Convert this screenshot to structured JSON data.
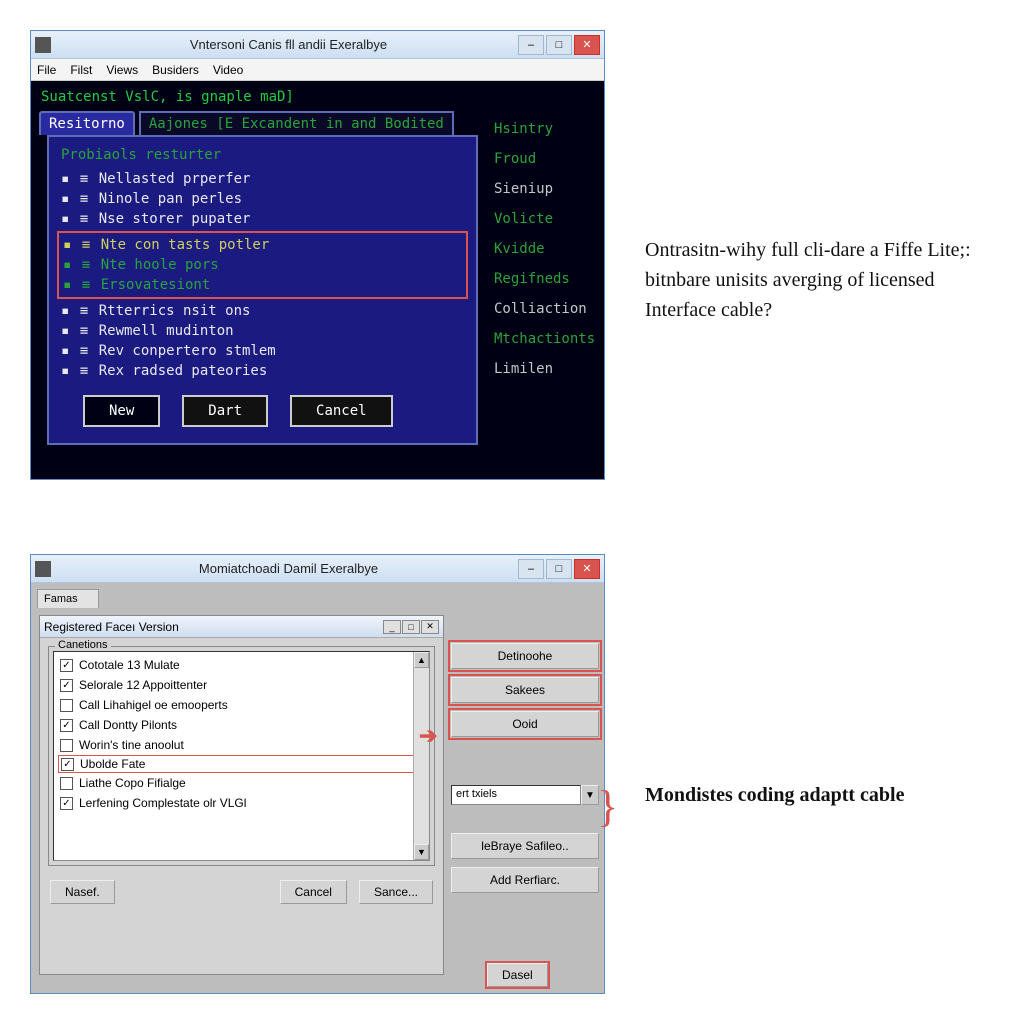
{
  "win1": {
    "title": "Vntersoni Canis fll andii Exeralbye",
    "menu": [
      "File",
      "Filst",
      "Views",
      "Busiders",
      "Video"
    ],
    "status": "Suatcenst VslC, is gnaple maD]",
    "tabs": [
      "Resitorno",
      "Aajones [E Excandent in and Bodited"
    ],
    "panel_heading": "Probiaols resturter",
    "list_pre": [
      "Nellasted prperfer",
      "Ninole pan perles",
      "Nse storer pupater"
    ],
    "list_hl": [
      "Nte con tasts potler",
      "Nte hoole pors",
      "Ersovatesiont"
    ],
    "list_post": [
      "Rtterrics nsit ons",
      "Rewmell mudinton",
      "Rev conpertero stmlem",
      "Rex radsed pateories"
    ],
    "buttons": [
      "New",
      "Dart",
      "Cancel"
    ],
    "sidebar": [
      "Hsintry",
      "Froud",
      "Sieniup",
      "Volicte",
      "Kvidde",
      "Regifneds",
      "Colliaction",
      "Mtchactionts",
      "Limilen"
    ]
  },
  "caption1": "Ontrasitn-wihy full cli-dare a Fiffe Lite;: bitnbare unisits averging of licensed Interface cable?",
  "caption2": "Mondistes coding adaptt cable",
  "win2": {
    "title": "Momiatchoadi Damil Exeralbye",
    "back_tab": "Famas",
    "inner_title": "Registered Faceı Version",
    "groupbox": "Canetions",
    "checks": [
      {
        "checked": true,
        "label": "Cototale 13 Mulate"
      },
      {
        "checked": true,
        "label": "Selorale 12 Appoittenter"
      },
      {
        "checked": false,
        "label": "Call Lihahigel oe emooperts"
      },
      {
        "checked": true,
        "label": "Call Dontty Pilonts"
      },
      {
        "checked": false,
        "label": "Worin's tine anoolut"
      },
      {
        "checked": true,
        "label": "Ubolde Fate",
        "hl": true
      },
      {
        "checked": false,
        "label": "Liathe Copo Fifialge"
      },
      {
        "checked": true,
        "label": "Lerfening Complestate olr VLGl"
      }
    ],
    "dlg_buttons": [
      "Nasef.",
      "Cancel",
      "Sance..."
    ],
    "right": {
      "btns": [
        "Detinoohe",
        "Sakees",
        "Ooid"
      ],
      "dropdown": "ert txiels",
      "more": [
        "leBraye Safileo..",
        "Add Rerfiarc."
      ],
      "bottom": "Dasel"
    }
  }
}
